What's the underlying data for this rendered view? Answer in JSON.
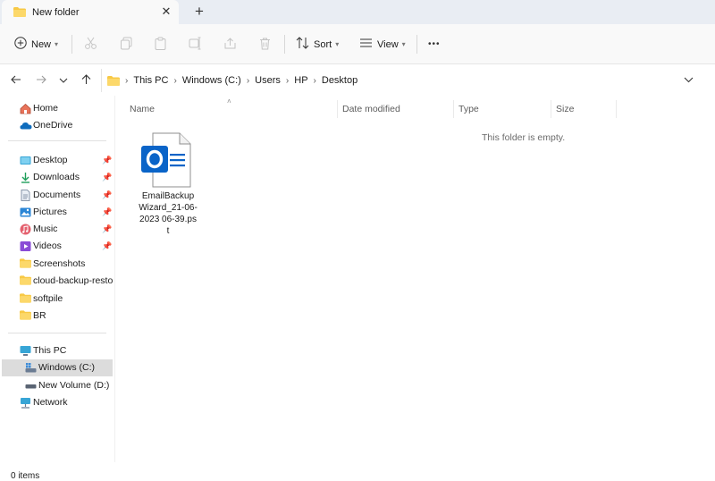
{
  "tab": {
    "title": "New folder",
    "close": "✕",
    "new_tab": "+"
  },
  "toolbar": {
    "new_label": "New",
    "sort_label": "Sort",
    "view_label": "View",
    "more": "•••"
  },
  "address": {
    "crumbs": [
      "This PC",
      "Windows (C:)",
      "Users",
      "HP",
      "Desktop"
    ]
  },
  "sidebar": {
    "home": "Home",
    "onedrive": "OneDrive",
    "quick": [
      "Desktop",
      "Downloads",
      "Documents",
      "Pictures",
      "Music",
      "Videos",
      "Screenshots",
      "cloud-backup-restore",
      "softpile",
      "BR"
    ],
    "this_pc": "This PC",
    "windows_c": "Windows (C:)",
    "new_volume": "New Volume (D:)",
    "network": "Network"
  },
  "columns": {
    "name": "Name",
    "date": "Date modified",
    "type": "Type",
    "size": "Size"
  },
  "content": {
    "empty_message": "This folder is empty.",
    "file_name": "EmailBackupWizard_21-06-2023 06-39.pst"
  },
  "status": {
    "items": "0 items"
  },
  "colors": {
    "accent": "#0f6cbd",
    "folder": "#f8c945",
    "outlook": "#0a64c8"
  }
}
